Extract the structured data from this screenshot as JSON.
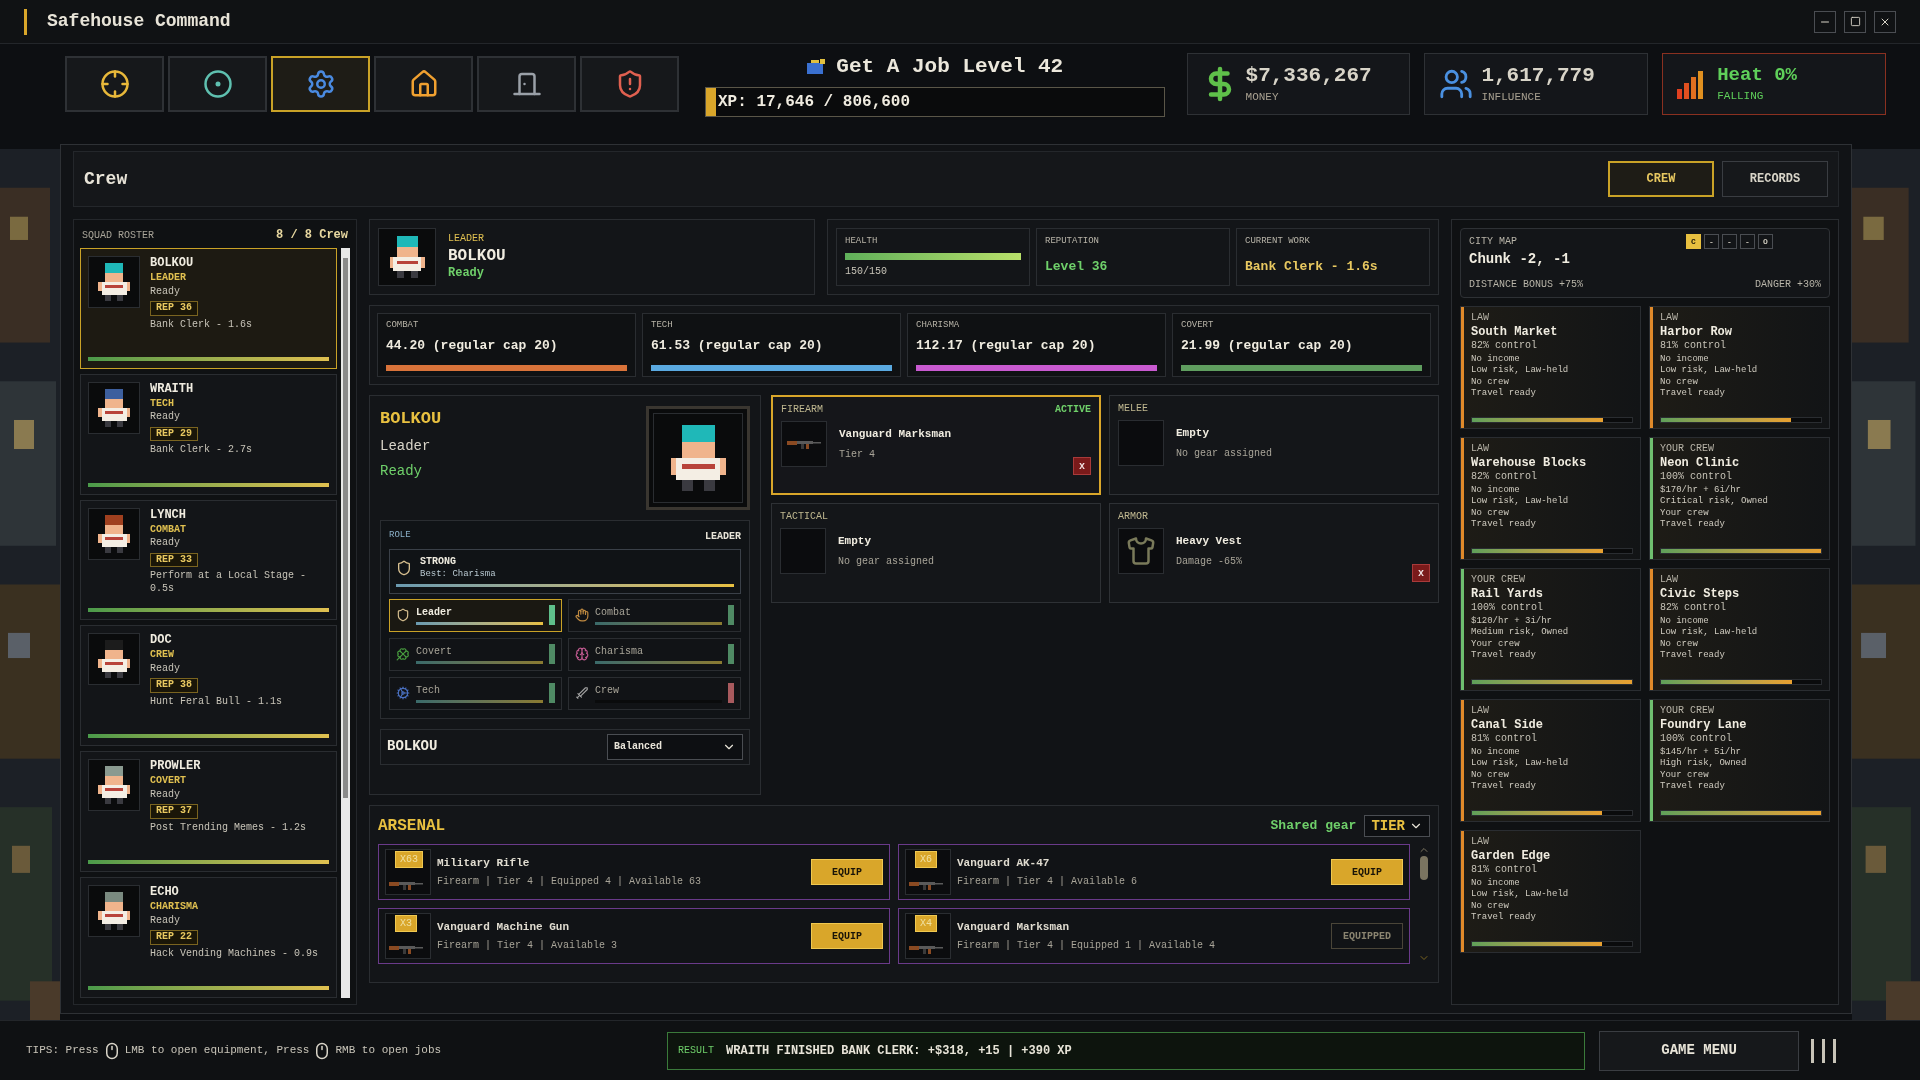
{
  "window": {
    "title": "Safehouse Command"
  },
  "toolbar": [
    {
      "kind": "crosshair",
      "selected": false
    },
    {
      "kind": "radar",
      "selected": false
    },
    {
      "kind": "gear",
      "selected": true
    },
    {
      "kind": "house",
      "selected": false
    },
    {
      "kind": "door",
      "selected": false
    },
    {
      "kind": "shield",
      "selected": false
    }
  ],
  "job": {
    "title": "Get A Job Level 42",
    "xp": "XP: 17,646 / 806,600",
    "level": 0.022
  },
  "money": {
    "value": "$7,336,267",
    "label": "MONEY"
  },
  "influence": {
    "value": "1,617,779",
    "label": "INFLUENCE"
  },
  "heat": {
    "value": "Heat 0%",
    "label": "FALLING"
  },
  "panel": {
    "title": "Crew",
    "tabs": [
      {
        "label": "CREW",
        "selected": true
      },
      {
        "label": "RECORDS",
        "selected": false
      }
    ]
  },
  "roster": {
    "title": "SQUAD ROSTER",
    "count": "8 / 8 Crew",
    "members": [
      {
        "name": "BOLKOU",
        "role": "LEADER",
        "status": "Ready",
        "rep": "REP 36",
        "work": "Bank Clerk - 1.6s",
        "level": 1,
        "color": "#1fb8b8",
        "selected": true
      },
      {
        "name": "WRAITH",
        "role": "TECH",
        "status": "Ready",
        "rep": "REP 29",
        "work": "Bank Clerk - 2.7s",
        "level": 1,
        "color": "#3d5f9e",
        "selected": false
      },
      {
        "name": "LYNCH",
        "role": "COMBAT",
        "status": "Ready",
        "rep": "REP 33",
        "work": "Perform at a Local Stage - 0.5s",
        "level": 1,
        "color": "#a0401f",
        "selected": false
      },
      {
        "name": "DOC",
        "role": "CREW",
        "status": "Ready",
        "rep": "REP 38",
        "work": "Hunt Feral Bull - 1.1s",
        "level": 1,
        "color": "#1c1c1c",
        "selected": false
      },
      {
        "name": "PROWLER",
        "role": "COVERT",
        "status": "Ready",
        "rep": "REP 37",
        "work": "Post Trending Memes - 1.2s",
        "level": 1,
        "color": "#8a9a90",
        "selected": false
      },
      {
        "name": "ECHO",
        "role": "CHARISMA",
        "status": "Ready",
        "rep": "REP 22",
        "work": "Hack Vending Machines - 0.9s",
        "level": 1,
        "color": "#7a8a80",
        "selected": false
      }
    ]
  },
  "leader": {
    "label": "LEADER",
    "name": "BOLKOU",
    "status": "Ready"
  },
  "vitals": {
    "health": {
      "label": "HEALTH",
      "reading": "150/150",
      "level": 1
    },
    "reputation": {
      "label": "REPUTATION",
      "value": "Level 36"
    },
    "current_work": {
      "label": "CURRENT WORK",
      "value": "Bank Clerk - 1.6s"
    }
  },
  "attributes": [
    {
      "label": "COMBAT",
      "value": "44.20 (regular cap 20)",
      "color": "#d9733a",
      "level": 1
    },
    {
      "label": "TECH",
      "value": "61.53 (regular cap 20)",
      "color": "#5aa9e0",
      "level": 1
    },
    {
      "label": "CHARISMA",
      "value": "112.17 (regular cap 20)",
      "color": "#c85ad0",
      "level": 1
    },
    {
      "label": "COVERT",
      "value": "21.99 (regular cap 20)",
      "color": "#5f9e5f",
      "level": 1
    }
  ],
  "character": {
    "name": "BOLKOU",
    "role": "Leader",
    "status": "Ready",
    "role_panel": {
      "label": "ROLE",
      "current": "LEADER",
      "trait": "STRONG",
      "best": "Best: Charisma",
      "level": 1
    },
    "roles": [
      {
        "kind": "shield",
        "label": "Leader",
        "selected": true,
        "level": 1,
        "color": "#5fbf8a"
      },
      {
        "kind": "fist",
        "label": "Combat",
        "selected": false,
        "level": 1,
        "color": "#4f8a64"
      },
      {
        "kind": "clover",
        "label": "Covert",
        "selected": false,
        "level": 1,
        "color": "#4f8a64"
      },
      {
        "kind": "brain",
        "label": "Charisma",
        "selected": false,
        "level": 1,
        "color": "#4f8a64"
      },
      {
        "kind": "gear",
        "label": "Tech",
        "selected": false,
        "level": 1,
        "color": "#4f8a64"
      },
      {
        "kind": "knife",
        "label": "Crew",
        "selected": false,
        "level": 0,
        "color": "#a85a5e"
      }
    ],
    "footer_name": "BOLKOU",
    "strategy": "Balanced"
  },
  "gear": [
    {
      "slot": "FIREARM",
      "selected": true,
      "badge": "ACTIVE",
      "kind": "rifle",
      "item": "Vanguard Marksman",
      "detail": "Tier 4",
      "remove": "x"
    },
    {
      "slot": "MELEE",
      "selected": false,
      "kind": "empty",
      "item": "Empty",
      "detail": "No gear assigned"
    },
    {
      "slot": "TACTICAL",
      "selected": false,
      "kind": "empty",
      "item": "Empty",
      "detail": "No gear assigned"
    },
    {
      "slot": "ARMOR",
      "selected": false,
      "kind": "vest",
      "item": "Heavy Vest",
      "detail": "Damage -65%",
      "remove": "x"
    }
  ],
  "arsenal": {
    "title": "ARSENAL",
    "shared": "Shared gear",
    "sort": "TIER",
    "items": [
      {
        "count": "X63",
        "name": "Military Rifle",
        "detail": "Firearm | Tier 4 | Equipped 4 | Available 63",
        "action": "EQUIP",
        "kind": "equip"
      },
      {
        "count": "X6",
        "name": "Vanguard AK-47",
        "detail": "Firearm | Tier 4 | Available 6",
        "action": "EQUIP",
        "kind": "equip"
      },
      {
        "count": "X3",
        "name": "Vanguard Machine Gun",
        "detail": "Firearm | Tier 4 | Available 3",
        "action": "EQUIP",
        "kind": "equip"
      },
      {
        "count": "X4",
        "name": "Vanguard Marksman",
        "detail": "Firearm | Tier 4 | Equipped 1 | Available 4",
        "action": "EQUIPPED",
        "kind": "equipped"
      }
    ]
  },
  "city_map": {
    "title": "CITY MAP",
    "chunk": "Chunk -2, -1",
    "distance": "DISTANCE BONUS +75%",
    "danger": "DANGER +30%",
    "nav": [
      {
        "label": "C",
        "selected": true
      },
      {
        "label": "-",
        "selected": false
      },
      {
        "label": "-",
        "selected": false
      },
      {
        "label": "-",
        "selected": false
      },
      {
        "label": "O",
        "selected": false
      }
    ],
    "districts": [
      {
        "faction": "LAW",
        "name": "South Market",
        "control": "82% control",
        "lines": [
          "No income",
          "Low risk, Law-held",
          "No crew",
          "Travel ready"
        ],
        "level": 0.82,
        "color": "#e08a2a"
      },
      {
        "faction": "LAW",
        "name": "Harbor Row",
        "control": "81% control",
        "lines": [
          "No income",
          "Low risk, Law-held",
          "No crew",
          "Travel ready"
        ],
        "level": 0.81,
        "color": "#e08a2a"
      },
      {
        "faction": "LAW",
        "name": "Warehouse Blocks",
        "control": "82% control",
        "lines": [
          "No income",
          "Low risk, Law-held",
          "No crew",
          "Travel ready"
        ],
        "level": 0.82,
        "color": "#e08a2a"
      },
      {
        "faction": "YOUR CREW",
        "name": "Neon Clinic",
        "control": "100% control",
        "lines": [
          "$170/hr + 6i/hr",
          "Critical risk, Owned",
          "Your crew",
          "Travel ready"
        ],
        "level": 1,
        "color": "#6fbf6f"
      },
      {
        "faction": "YOUR CREW",
        "name": "Rail Yards",
        "control": "100% control",
        "lines": [
          "$120/hr + 3i/hr",
          "Medium risk, Owned",
          "Your crew",
          "Travel ready"
        ],
        "level": 1,
        "color": "#6fbf6f"
      },
      {
        "faction": "LAW",
        "name": "Civic Steps",
        "control": "82% control",
        "lines": [
          "No income",
          "Low risk, Law-held",
          "No crew",
          "Travel ready"
        ],
        "level": 0.82,
        "color": "#e08a2a"
      },
      {
        "faction": "LAW",
        "name": "Canal Side",
        "control": "81% control",
        "lines": [
          "No income",
          "Low risk, Law-held",
          "No crew",
          "Travel ready"
        ],
        "level": 0.81,
        "color": "#e08a2a"
      },
      {
        "faction": "YOUR CREW",
        "name": "Foundry Lane",
        "control": "100% control",
        "lines": [
          "$145/hr + 5i/hr",
          "High risk, Owned",
          "Your crew",
          "Travel ready"
        ],
        "level": 1,
        "color": "#6fbf6f"
      },
      {
        "faction": "LAW",
        "name": "Garden Edge",
        "control": "81% control",
        "lines": [
          "No income",
          "Low risk, Law-held",
          "No crew",
          "Travel ready"
        ],
        "level": 0.81,
        "color": "#e08a2a"
      }
    ]
  },
  "tips": {
    "lead": "TIPS: Press",
    "first": "LMB to open equipment, Press",
    "second": "RMB to open jobs"
  },
  "result": {
    "label": "RESULT",
    "text": "WRAITH FINISHED BANK CLERK: +$318, +15 | +390 XP"
  },
  "menu": "GAME MENU"
}
